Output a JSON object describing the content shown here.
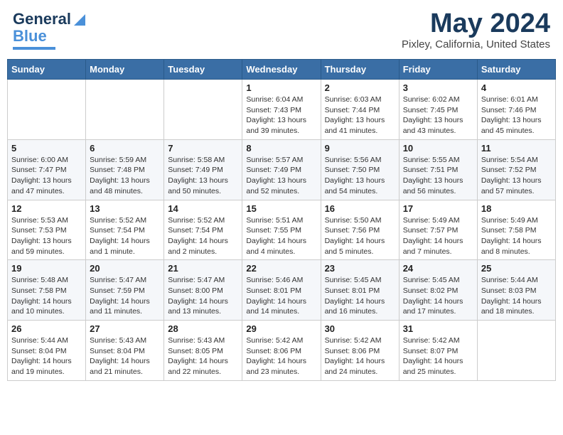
{
  "header": {
    "logo_general": "General",
    "logo_blue": "Blue",
    "month_title": "May 2024",
    "location": "Pixley, California, United States"
  },
  "weekdays": [
    "Sunday",
    "Monday",
    "Tuesday",
    "Wednesday",
    "Thursday",
    "Friday",
    "Saturday"
  ],
  "weeks": [
    [
      {
        "day": "",
        "info": ""
      },
      {
        "day": "",
        "info": ""
      },
      {
        "day": "",
        "info": ""
      },
      {
        "day": "1",
        "info": "Sunrise: 6:04 AM\nSunset: 7:43 PM\nDaylight: 13 hours\nand 39 minutes."
      },
      {
        "day": "2",
        "info": "Sunrise: 6:03 AM\nSunset: 7:44 PM\nDaylight: 13 hours\nand 41 minutes."
      },
      {
        "day": "3",
        "info": "Sunrise: 6:02 AM\nSunset: 7:45 PM\nDaylight: 13 hours\nand 43 minutes."
      },
      {
        "day": "4",
        "info": "Sunrise: 6:01 AM\nSunset: 7:46 PM\nDaylight: 13 hours\nand 45 minutes."
      }
    ],
    [
      {
        "day": "5",
        "info": "Sunrise: 6:00 AM\nSunset: 7:47 PM\nDaylight: 13 hours\nand 47 minutes."
      },
      {
        "day": "6",
        "info": "Sunrise: 5:59 AM\nSunset: 7:48 PM\nDaylight: 13 hours\nand 48 minutes."
      },
      {
        "day": "7",
        "info": "Sunrise: 5:58 AM\nSunset: 7:49 PM\nDaylight: 13 hours\nand 50 minutes."
      },
      {
        "day": "8",
        "info": "Sunrise: 5:57 AM\nSunset: 7:49 PM\nDaylight: 13 hours\nand 52 minutes."
      },
      {
        "day": "9",
        "info": "Sunrise: 5:56 AM\nSunset: 7:50 PM\nDaylight: 13 hours\nand 54 minutes."
      },
      {
        "day": "10",
        "info": "Sunrise: 5:55 AM\nSunset: 7:51 PM\nDaylight: 13 hours\nand 56 minutes."
      },
      {
        "day": "11",
        "info": "Sunrise: 5:54 AM\nSunset: 7:52 PM\nDaylight: 13 hours\nand 57 minutes."
      }
    ],
    [
      {
        "day": "12",
        "info": "Sunrise: 5:53 AM\nSunset: 7:53 PM\nDaylight: 13 hours\nand 59 minutes."
      },
      {
        "day": "13",
        "info": "Sunrise: 5:52 AM\nSunset: 7:54 PM\nDaylight: 14 hours\nand 1 minute."
      },
      {
        "day": "14",
        "info": "Sunrise: 5:52 AM\nSunset: 7:54 PM\nDaylight: 14 hours\nand 2 minutes."
      },
      {
        "day": "15",
        "info": "Sunrise: 5:51 AM\nSunset: 7:55 PM\nDaylight: 14 hours\nand 4 minutes."
      },
      {
        "day": "16",
        "info": "Sunrise: 5:50 AM\nSunset: 7:56 PM\nDaylight: 14 hours\nand 5 minutes."
      },
      {
        "day": "17",
        "info": "Sunrise: 5:49 AM\nSunset: 7:57 PM\nDaylight: 14 hours\nand 7 minutes."
      },
      {
        "day": "18",
        "info": "Sunrise: 5:49 AM\nSunset: 7:58 PM\nDaylight: 14 hours\nand 8 minutes."
      }
    ],
    [
      {
        "day": "19",
        "info": "Sunrise: 5:48 AM\nSunset: 7:58 PM\nDaylight: 14 hours\nand 10 minutes."
      },
      {
        "day": "20",
        "info": "Sunrise: 5:47 AM\nSunset: 7:59 PM\nDaylight: 14 hours\nand 11 minutes."
      },
      {
        "day": "21",
        "info": "Sunrise: 5:47 AM\nSunset: 8:00 PM\nDaylight: 14 hours\nand 13 minutes."
      },
      {
        "day": "22",
        "info": "Sunrise: 5:46 AM\nSunset: 8:01 PM\nDaylight: 14 hours\nand 14 minutes."
      },
      {
        "day": "23",
        "info": "Sunrise: 5:45 AM\nSunset: 8:01 PM\nDaylight: 14 hours\nand 16 minutes."
      },
      {
        "day": "24",
        "info": "Sunrise: 5:45 AM\nSunset: 8:02 PM\nDaylight: 14 hours\nand 17 minutes."
      },
      {
        "day": "25",
        "info": "Sunrise: 5:44 AM\nSunset: 8:03 PM\nDaylight: 14 hours\nand 18 minutes."
      }
    ],
    [
      {
        "day": "26",
        "info": "Sunrise: 5:44 AM\nSunset: 8:04 PM\nDaylight: 14 hours\nand 19 minutes."
      },
      {
        "day": "27",
        "info": "Sunrise: 5:43 AM\nSunset: 8:04 PM\nDaylight: 14 hours\nand 21 minutes."
      },
      {
        "day": "28",
        "info": "Sunrise: 5:43 AM\nSunset: 8:05 PM\nDaylight: 14 hours\nand 22 minutes."
      },
      {
        "day": "29",
        "info": "Sunrise: 5:42 AM\nSunset: 8:06 PM\nDaylight: 14 hours\nand 23 minutes."
      },
      {
        "day": "30",
        "info": "Sunrise: 5:42 AM\nSunset: 8:06 PM\nDaylight: 14 hours\nand 24 minutes."
      },
      {
        "day": "31",
        "info": "Sunrise: 5:42 AM\nSunset: 8:07 PM\nDaylight: 14 hours\nand 25 minutes."
      },
      {
        "day": "",
        "info": ""
      }
    ]
  ]
}
